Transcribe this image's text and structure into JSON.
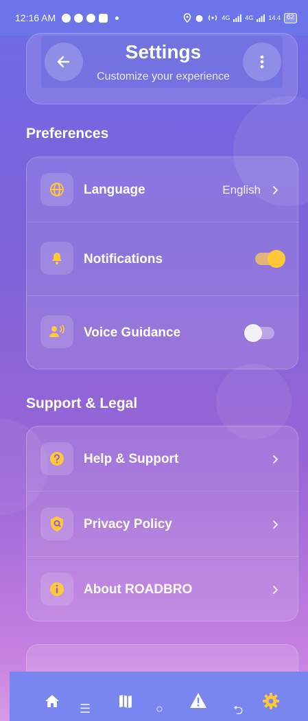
{
  "status_bar": {
    "time": "12:16 AM",
    "network_label": "4G",
    "network_label_2": "4G",
    "speed": "14.4",
    "battery": "62"
  },
  "header": {
    "title": "Settings",
    "subtitle": "Customize your experience",
    "back_icon": "arrow-left-icon",
    "menu_icon": "more-vertical-icon"
  },
  "sections": {
    "preferences": {
      "title": "Preferences",
      "items": [
        {
          "label": "Language",
          "value": "English",
          "icon": "globe-icon"
        },
        {
          "label": "Notifications",
          "icon": "bell-icon",
          "toggle": true
        },
        {
          "label": "Voice Guidance",
          "icon": "voice-icon",
          "toggle": false
        }
      ]
    },
    "support": {
      "title": "Support & Legal",
      "items": [
        {
          "label": "Help & Support",
          "icon": "help-icon"
        },
        {
          "label": "Privacy Policy",
          "icon": "shield-icon"
        },
        {
          "label": "About ROADBRO",
          "icon": "info-icon"
        }
      ]
    }
  },
  "colors": {
    "accent": "#ffc83a",
    "nav_bar": "#7a86f0",
    "status_bar": "#6c74ea"
  },
  "bottom_nav": {
    "items": [
      "home-icon",
      "map-icon",
      "alert-icon",
      "gear-icon"
    ]
  }
}
